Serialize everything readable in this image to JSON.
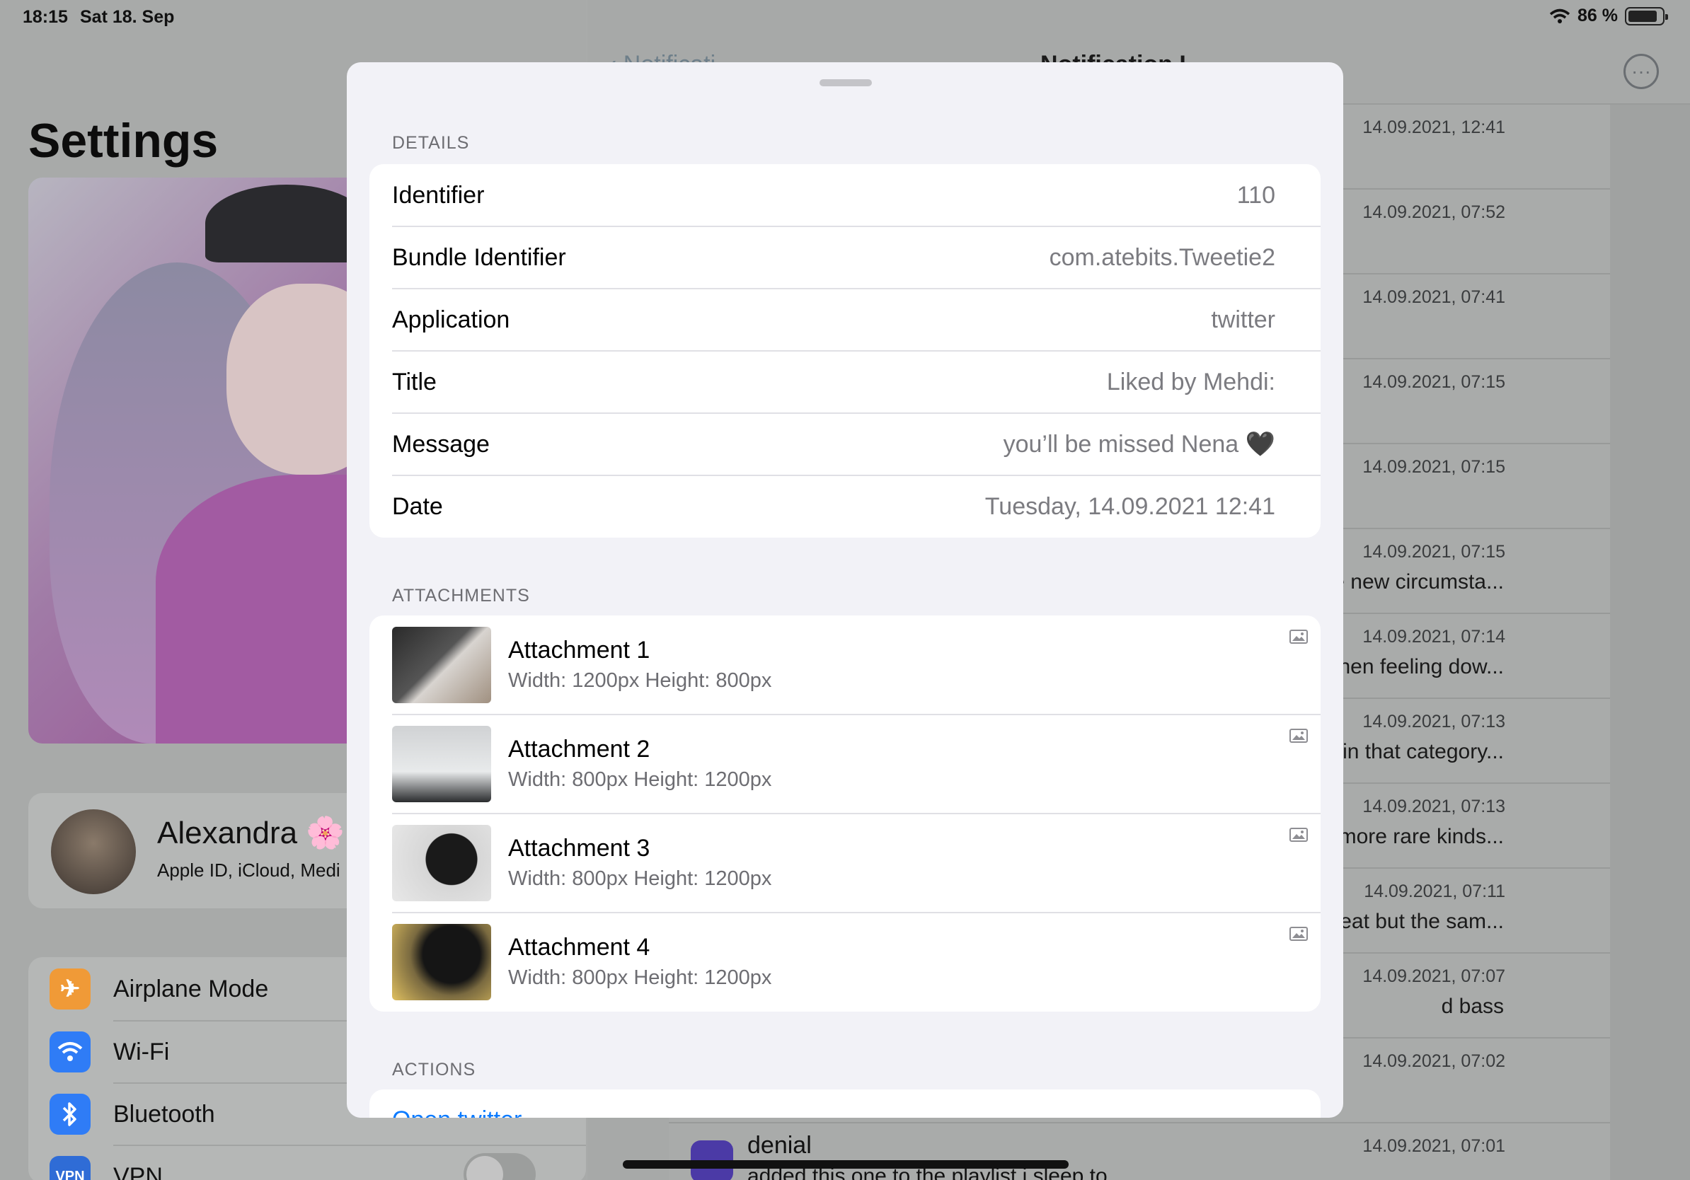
{
  "status_bar": {
    "time": "18:15",
    "date": "Sat 18. Sep",
    "battery": "86 %",
    "battery_level": 0.86
  },
  "settings": {
    "title": "Settings",
    "profile": {
      "name": "Alexandra 🌸",
      "subtitle": "Apple ID, iCloud, Medi"
    },
    "items": [
      {
        "label": "Airplane Mode",
        "icon": "airplane-icon",
        "color": "#f09a37"
      },
      {
        "label": "Wi-Fi",
        "icon": "wifi-icon",
        "color": "#2f7cf6"
      },
      {
        "label": "Bluetooth",
        "icon": "bluetooth-icon",
        "color": "#2f7cf6"
      },
      {
        "label": "VPN",
        "icon": "vpn-icon",
        "color": "#2f6cd6"
      }
    ]
  },
  "notifications": {
    "back_label": "Notificati",
    "title": "Notification L",
    "rows": [
      {
        "date": "14.09.2021, 12:41",
        "text": ""
      },
      {
        "date": "14.09.2021, 07:52",
        "text": ""
      },
      {
        "date": "14.09.2021, 07:41",
        "text": ""
      },
      {
        "date": "14.09.2021, 07:15",
        "text": ""
      },
      {
        "date": "14.09.2021, 07:15",
        "text": ""
      },
      {
        "date": "14.09.2021, 07:15",
        "text": "n with the new circumsta..."
      },
      {
        "date": "14.09.2021, 07:14",
        "text": ") them when feeling dow..."
      },
      {
        "date": "14.09.2021, 07:13",
        "text": "kes falls in that category..."
      },
      {
        "date": "14.09.2021, 07:13",
        "text": ", but the more rare kinds..."
      },
      {
        "date": "14.09.2021, 07:11",
        "text": "a faster beat but the sam..."
      },
      {
        "date": "14.09.2021, 07:07",
        "text": "d bass"
      },
      {
        "date": "14.09.2021, 07:02",
        "text": ""
      },
      {
        "date": "14.09.2021, 07:01",
        "text": ""
      }
    ],
    "last": {
      "app": "denial",
      "message": "added this one to the playlist i sleep to"
    }
  },
  "sheet": {
    "details_label": "DETAILS",
    "details": [
      {
        "key": "Identifier",
        "value": "110"
      },
      {
        "key": "Bundle Identifier",
        "value": "com.atebits.Tweetie2"
      },
      {
        "key": "Application",
        "value": "twitter"
      },
      {
        "key": "Title",
        "value": "Liked by Mehdi:"
      },
      {
        "key": "Message",
        "value": "you’ll be missed Nena 🖤"
      },
      {
        "key": "Date",
        "value": "Tuesday, 14.09.2021 12:41"
      }
    ],
    "attachments_label": "ATTACHMENTS",
    "attachments": [
      {
        "title": "Attachment 1",
        "size": "Width: 1200px Height: 800px"
      },
      {
        "title": "Attachment 2",
        "size": "Width: 800px Height: 1200px"
      },
      {
        "title": "Attachment 3",
        "size": "Width: 800px Height: 1200px"
      },
      {
        "title": "Attachment 4",
        "size": "Width: 800px Height: 1200px"
      }
    ],
    "actions_label": "ACTIONS",
    "action_open": "Open twitter"
  }
}
